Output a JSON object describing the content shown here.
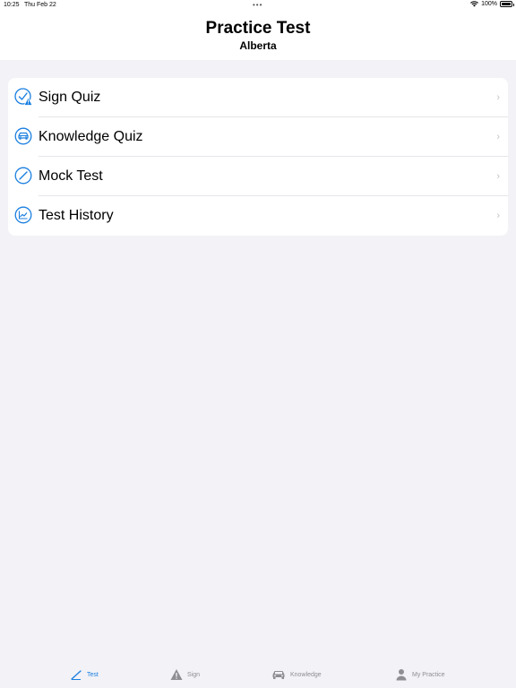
{
  "status_bar": {
    "time": "10:25",
    "date": "Thu Feb 22",
    "dots": "•••",
    "battery_percent": "100%",
    "battery_level": 1.0
  },
  "header": {
    "title": "Practice Test",
    "subtitle": "Alberta"
  },
  "menu": {
    "items": [
      {
        "label": "Sign Quiz",
        "icon": "check-warning-icon"
      },
      {
        "label": "Knowledge Quiz",
        "icon": "car-icon"
      },
      {
        "label": "Mock Test",
        "icon": "pencil-icon"
      },
      {
        "label": "Test History",
        "icon": "chart-icon"
      }
    ],
    "chevron": "›"
  },
  "tabs": [
    {
      "label": "Test",
      "icon": "pencil-tab-icon",
      "active": true
    },
    {
      "label": "Sign",
      "icon": "warning-tab-icon",
      "active": false
    },
    {
      "label": "Knowledge",
      "icon": "car-tab-icon",
      "active": false
    },
    {
      "label": "My Practice",
      "icon": "person-tab-icon",
      "active": false
    }
  ],
  "colors": {
    "accent": "#1a7fe0",
    "background": "#f2f2f7",
    "inactive_tab": "#8e8e93"
  }
}
